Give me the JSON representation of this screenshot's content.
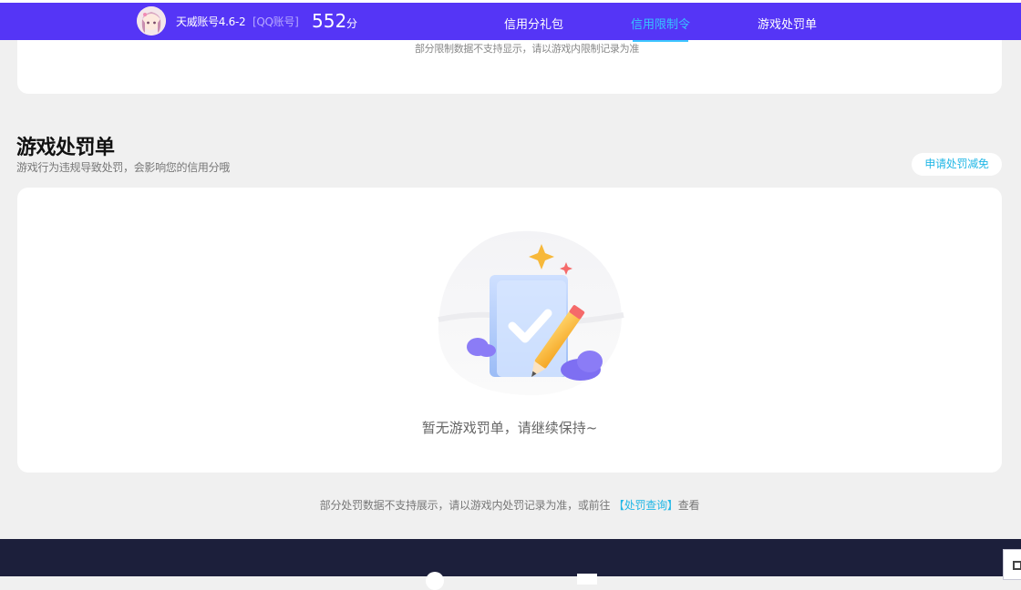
{
  "header": {
    "account_name": "天威账号4.6-2",
    "account_type": "[QQ账号]",
    "score": "552",
    "score_unit": "分",
    "tabs": [
      {
        "label": "信用分礼包",
        "active": false
      },
      {
        "label": "信用限制令",
        "active": true
      },
      {
        "label": "游戏处罚单",
        "active": false
      }
    ],
    "colors": {
      "nav_bg": "#5535f6",
      "active_tab": "#36c5ff"
    }
  },
  "restriction": {
    "note": "部分限制数据不支持显示，请以游戏内限制记录为准"
  },
  "penalty": {
    "title": "游戏处罚单",
    "subtitle": "游戏行为违规导致处罚，会影响您的信用分哦",
    "apply_button": "申请处罚减免",
    "empty_text": "暂无游戏罚单，请继续保持~",
    "footer_prefix": "部分处罚数据不支持展示，请以游戏内处罚记录为准，或前往",
    "footer_link": "【处罚查询】",
    "footer_suffix": "查看"
  },
  "icons": {
    "avatar": "user-avatar",
    "illustration": "empty-clipboard-pencil-illustration",
    "corner": "qr-code-icon"
  }
}
